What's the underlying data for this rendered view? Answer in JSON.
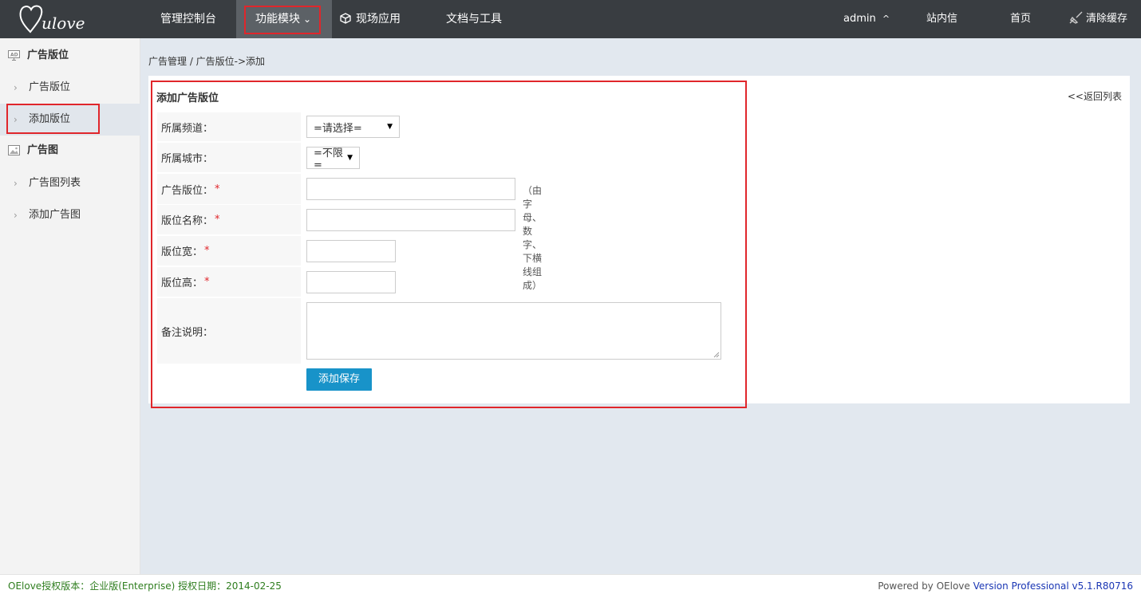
{
  "header": {
    "logo_text": "ulove",
    "nav": [
      {
        "label": "管理控制台"
      },
      {
        "label": "功能模块",
        "caret": "⌄"
      },
      {
        "label": "现场应用"
      },
      {
        "label": "文档与工具"
      }
    ],
    "right": {
      "user": "admin",
      "user_caret": "^",
      "messages": "站内信",
      "home": "首页",
      "clear_cache": "清除缓存"
    }
  },
  "sidebar": {
    "groups": [
      {
        "title": "广告版位",
        "icon": "ad-icon",
        "items": [
          {
            "label": "广告版位"
          },
          {
            "label": "添加版位"
          }
        ]
      },
      {
        "title": "广告图",
        "icon": "image-icon",
        "items": [
          {
            "label": "广告图列表"
          },
          {
            "label": "添加广告图"
          }
        ]
      }
    ]
  },
  "breadcrumb": "广告管理 / 广告版位->添加",
  "form": {
    "title": "添加广告版位",
    "back_link": "<<返回列表",
    "fields": {
      "channel": {
        "label": "所属频道：",
        "value": "=请选择="
      },
      "city": {
        "label": "所属城市：",
        "value": "=不限="
      },
      "position": {
        "label": "广告版位：",
        "required": "*",
        "hint": "（由字母、数字、下横线组成）",
        "value": ""
      },
      "name": {
        "label": "版位名称：",
        "required": "*",
        "value": ""
      },
      "width": {
        "label": "版位宽：",
        "required": "*",
        "value": ""
      },
      "height": {
        "label": "版位高：",
        "required": "*",
        "value": ""
      },
      "remark": {
        "label": "备注说明：",
        "value": ""
      }
    },
    "submit": "添加保存"
  },
  "footer": {
    "license": "OElove授权版本：企业版(Enterprise) 授权日期：2014-02-25",
    "powered_prefix": "Powered by OElove ",
    "version": "Version Professional v5.1.R80716"
  },
  "colors": {
    "topbar": "#393d41",
    "highlight": "#e0262b",
    "button": "#1893c9",
    "license_text": "#2e7d1e",
    "version_text": "#1a36b4"
  }
}
